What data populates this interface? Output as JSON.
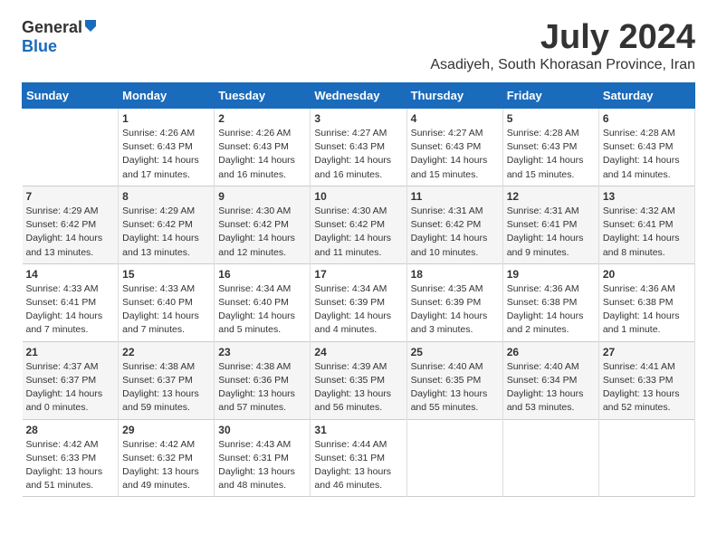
{
  "logo": {
    "general": "General",
    "blue": "Blue"
  },
  "title": {
    "month_year": "July 2024",
    "location": "Asadiyeh, South Khorasan Province, Iran"
  },
  "days_of_week": [
    "Sunday",
    "Monday",
    "Tuesday",
    "Wednesday",
    "Thursday",
    "Friday",
    "Saturday"
  ],
  "weeks": [
    [
      {
        "day": "",
        "info": ""
      },
      {
        "day": "1",
        "info": "Sunrise: 4:26 AM\nSunset: 6:43 PM\nDaylight: 14 hours\nand 17 minutes."
      },
      {
        "day": "2",
        "info": "Sunrise: 4:26 AM\nSunset: 6:43 PM\nDaylight: 14 hours\nand 16 minutes."
      },
      {
        "day": "3",
        "info": "Sunrise: 4:27 AM\nSunset: 6:43 PM\nDaylight: 14 hours\nand 16 minutes."
      },
      {
        "day": "4",
        "info": "Sunrise: 4:27 AM\nSunset: 6:43 PM\nDaylight: 14 hours\nand 15 minutes."
      },
      {
        "day": "5",
        "info": "Sunrise: 4:28 AM\nSunset: 6:43 PM\nDaylight: 14 hours\nand 15 minutes."
      },
      {
        "day": "6",
        "info": "Sunrise: 4:28 AM\nSunset: 6:43 PM\nDaylight: 14 hours\nand 14 minutes."
      }
    ],
    [
      {
        "day": "7",
        "info": "Sunrise: 4:29 AM\nSunset: 6:42 PM\nDaylight: 14 hours\nand 13 minutes."
      },
      {
        "day": "8",
        "info": "Sunrise: 4:29 AM\nSunset: 6:42 PM\nDaylight: 14 hours\nand 13 minutes."
      },
      {
        "day": "9",
        "info": "Sunrise: 4:30 AM\nSunset: 6:42 PM\nDaylight: 14 hours\nand 12 minutes."
      },
      {
        "day": "10",
        "info": "Sunrise: 4:30 AM\nSunset: 6:42 PM\nDaylight: 14 hours\nand 11 minutes."
      },
      {
        "day": "11",
        "info": "Sunrise: 4:31 AM\nSunset: 6:42 PM\nDaylight: 14 hours\nand 10 minutes."
      },
      {
        "day": "12",
        "info": "Sunrise: 4:31 AM\nSunset: 6:41 PM\nDaylight: 14 hours\nand 9 minutes."
      },
      {
        "day": "13",
        "info": "Sunrise: 4:32 AM\nSunset: 6:41 PM\nDaylight: 14 hours\nand 8 minutes."
      }
    ],
    [
      {
        "day": "14",
        "info": "Sunrise: 4:33 AM\nSunset: 6:41 PM\nDaylight: 14 hours\nand 7 minutes."
      },
      {
        "day": "15",
        "info": "Sunrise: 4:33 AM\nSunset: 6:40 PM\nDaylight: 14 hours\nand 7 minutes."
      },
      {
        "day": "16",
        "info": "Sunrise: 4:34 AM\nSunset: 6:40 PM\nDaylight: 14 hours\nand 5 minutes."
      },
      {
        "day": "17",
        "info": "Sunrise: 4:34 AM\nSunset: 6:39 PM\nDaylight: 14 hours\nand 4 minutes."
      },
      {
        "day": "18",
        "info": "Sunrise: 4:35 AM\nSunset: 6:39 PM\nDaylight: 14 hours\nand 3 minutes."
      },
      {
        "day": "19",
        "info": "Sunrise: 4:36 AM\nSunset: 6:38 PM\nDaylight: 14 hours\nand 2 minutes."
      },
      {
        "day": "20",
        "info": "Sunrise: 4:36 AM\nSunset: 6:38 PM\nDaylight: 14 hours\nand 1 minute."
      }
    ],
    [
      {
        "day": "21",
        "info": "Sunrise: 4:37 AM\nSunset: 6:37 PM\nDaylight: 14 hours\nand 0 minutes."
      },
      {
        "day": "22",
        "info": "Sunrise: 4:38 AM\nSunset: 6:37 PM\nDaylight: 13 hours\nand 59 minutes."
      },
      {
        "day": "23",
        "info": "Sunrise: 4:38 AM\nSunset: 6:36 PM\nDaylight: 13 hours\nand 57 minutes."
      },
      {
        "day": "24",
        "info": "Sunrise: 4:39 AM\nSunset: 6:35 PM\nDaylight: 13 hours\nand 56 minutes."
      },
      {
        "day": "25",
        "info": "Sunrise: 4:40 AM\nSunset: 6:35 PM\nDaylight: 13 hours\nand 55 minutes."
      },
      {
        "day": "26",
        "info": "Sunrise: 4:40 AM\nSunset: 6:34 PM\nDaylight: 13 hours\nand 53 minutes."
      },
      {
        "day": "27",
        "info": "Sunrise: 4:41 AM\nSunset: 6:33 PM\nDaylight: 13 hours\nand 52 minutes."
      }
    ],
    [
      {
        "day": "28",
        "info": "Sunrise: 4:42 AM\nSunset: 6:33 PM\nDaylight: 13 hours\nand 51 minutes."
      },
      {
        "day": "29",
        "info": "Sunrise: 4:42 AM\nSunset: 6:32 PM\nDaylight: 13 hours\nand 49 minutes."
      },
      {
        "day": "30",
        "info": "Sunrise: 4:43 AM\nSunset: 6:31 PM\nDaylight: 13 hours\nand 48 minutes."
      },
      {
        "day": "31",
        "info": "Sunrise: 4:44 AM\nSunset: 6:31 PM\nDaylight: 13 hours\nand 46 minutes."
      },
      {
        "day": "",
        "info": ""
      },
      {
        "day": "",
        "info": ""
      },
      {
        "day": "",
        "info": ""
      }
    ]
  ]
}
